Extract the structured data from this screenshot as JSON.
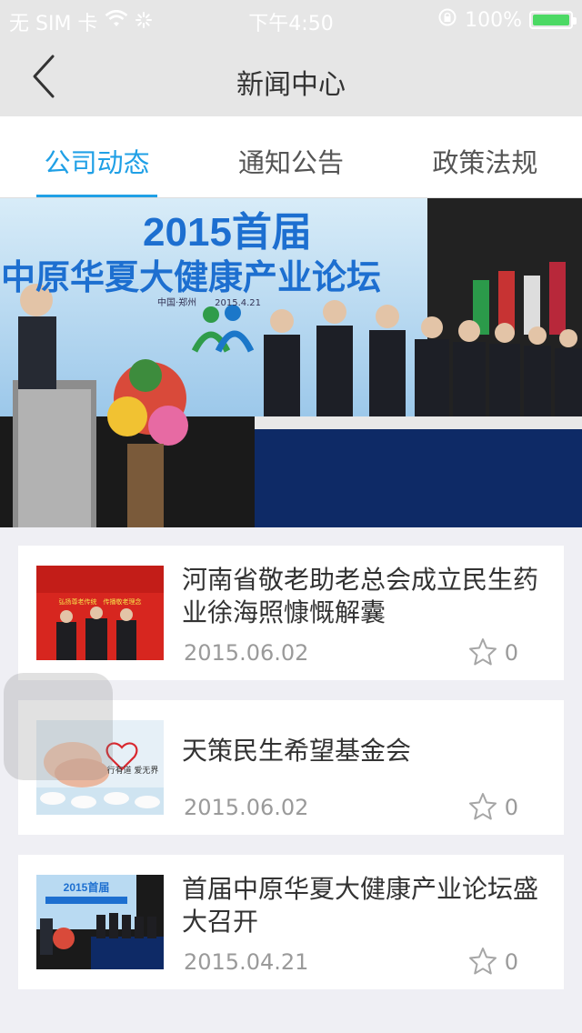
{
  "status_bar": {
    "carrier": "无 SIM 卡",
    "time": "下午4:50",
    "battery": "100%"
  },
  "nav": {
    "title": "新闻中心",
    "back_icon": "chevron-left-icon"
  },
  "tabs": [
    {
      "label": "公司动态",
      "active": true
    },
    {
      "label": "通知公告",
      "active": false
    },
    {
      "label": "政策法规",
      "active": false
    }
  ],
  "banner": {
    "headline_line1": "2015首届",
    "headline_line2": "中原华夏大健康产业论坛",
    "subline": "中国·郑州　　2015.4.21"
  },
  "news": [
    {
      "title": "河南省敬老助老总会成立民生药业徐海照慷慨解囊",
      "date": "2015.06.02",
      "favorites": "0",
      "thumb_text": "弘扬尊老传统　传播敬老理念"
    },
    {
      "title": "天策民生希望基金会",
      "date": "2015.06.02",
      "favorites": "0",
      "thumb_text": "行有道 爱无界"
    },
    {
      "title": "首届中原华夏大健康产业论坛盛大召开",
      "date": "2015.04.21",
      "favorites": "0",
      "thumb_text": "2015首届"
    }
  ],
  "colors": {
    "accent": "#20a0e6",
    "bar_bg": "#e6e6e6",
    "page_bg": "#efeff4"
  }
}
